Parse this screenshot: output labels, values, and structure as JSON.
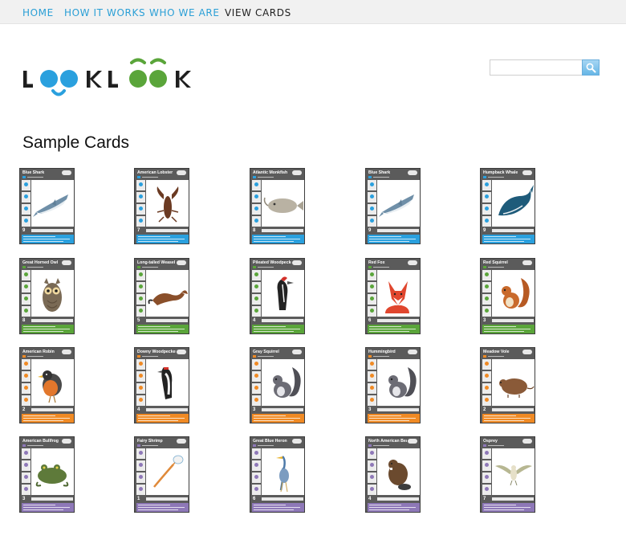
{
  "nav": {
    "items": [
      "HOME",
      "HOW IT WORKS",
      "WHO WE ARE",
      "VIEW CARDS"
    ]
  },
  "logo": {
    "text": "LOOKLOOK",
    "colors": {
      "dark": "#1f1f1f",
      "blue": "#2aa0de",
      "green": "#5aa53a"
    }
  },
  "search": {
    "placeholder": "",
    "value": ""
  },
  "page": {
    "title": "Sample Cards"
  },
  "cards": [
    {
      "name": "Blue Shark",
      "number": "9",
      "color": "#2aa0de",
      "art": "shark"
    },
    {
      "name": "American Lobster",
      "number": "7",
      "color": "#2aa0de",
      "art": "lobster"
    },
    {
      "name": "Atlantic Monkfish",
      "number": "8",
      "color": "#2aa0de",
      "art": "monkfish"
    },
    {
      "name": "Blue Shark",
      "number": "9",
      "color": "#2aa0de",
      "art": "shark"
    },
    {
      "name": "Humpback Whale",
      "number": "9",
      "color": "#2aa0de",
      "art": "whale"
    },
    {
      "name": "Great Horned Owl",
      "number": "8",
      "color": "#5aa53a",
      "art": "owl"
    },
    {
      "name": "Long-tailed Weasel",
      "number": "5",
      "color": "#5aa53a",
      "art": "weasel"
    },
    {
      "name": "Pileated Woodpecker",
      "number": "4",
      "color": "#5aa53a",
      "art": "woodpecker"
    },
    {
      "name": "Red Fox",
      "number": "6",
      "color": "#5aa53a",
      "art": "fox"
    },
    {
      "name": "Red Squirrel",
      "number": "3",
      "color": "#5aa53a",
      "art": "redsquirrel"
    },
    {
      "name": "American Robin",
      "number": "2",
      "color": "#f08a24",
      "art": "robin"
    },
    {
      "name": "Downy Woodpecker",
      "number": "4",
      "color": "#f08a24",
      "art": "downy"
    },
    {
      "name": "Gray Squirrel",
      "number": "3",
      "color": "#f08a24",
      "art": "graysquirrel"
    },
    {
      "name": "Hummingbird",
      "number": "3",
      "color": "#f08a24",
      "art": "graysquirrel"
    },
    {
      "name": "Meadow Vole",
      "number": "2",
      "color": "#f08a24",
      "art": "vole"
    },
    {
      "name": "American Bullfrog",
      "number": "3",
      "color": "#8e78b8",
      "art": "frog"
    },
    {
      "name": "Fairy Shrimp",
      "number": "1",
      "color": "#8e78b8",
      "art": "shrimp"
    },
    {
      "name": "Great Blue Heron",
      "number": "6",
      "color": "#8e78b8",
      "art": "heron"
    },
    {
      "name": "North American Beaver",
      "number": "4",
      "color": "#8e78b8",
      "art": "beaver"
    },
    {
      "name": "Osprey",
      "number": "7",
      "color": "#8e78b8",
      "art": "osprey"
    }
  ]
}
